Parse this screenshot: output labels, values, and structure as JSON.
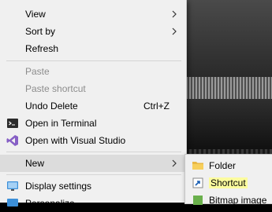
{
  "menu": {
    "items": [
      {
        "label": "View",
        "submenu": true
      },
      {
        "label": "Sort by",
        "submenu": true
      },
      {
        "label": "Refresh"
      },
      {
        "label": "Paste",
        "disabled": true
      },
      {
        "label": "Paste shortcut",
        "disabled": true
      },
      {
        "label": "Undo Delete",
        "shortcut": "Ctrl+Z"
      },
      {
        "label": "Open in Terminal",
        "icon": "terminal-icon"
      },
      {
        "label": "Open with Visual Studio",
        "icon": "visual-studio-icon"
      },
      {
        "label": "New",
        "submenu": true,
        "highlighted": true
      },
      {
        "label": "Display settings",
        "icon": "display-icon"
      },
      {
        "label": "Personalize",
        "icon": "personalize-icon"
      }
    ]
  },
  "submenu": {
    "items": [
      {
        "label": "Folder",
        "icon": "folder-icon"
      },
      {
        "label": "Shortcut",
        "icon": "shortcut-icon",
        "highlight_color": "#fbfb9e"
      },
      {
        "label": "Bitmap image",
        "icon": "bitmap-icon"
      }
    ]
  },
  "colors": {
    "menu_bg": "#f0f0f0",
    "hover_bg": "#dcdcdc",
    "disabled_text": "#8d8d8d",
    "highlighter": "#fbfb9e"
  }
}
